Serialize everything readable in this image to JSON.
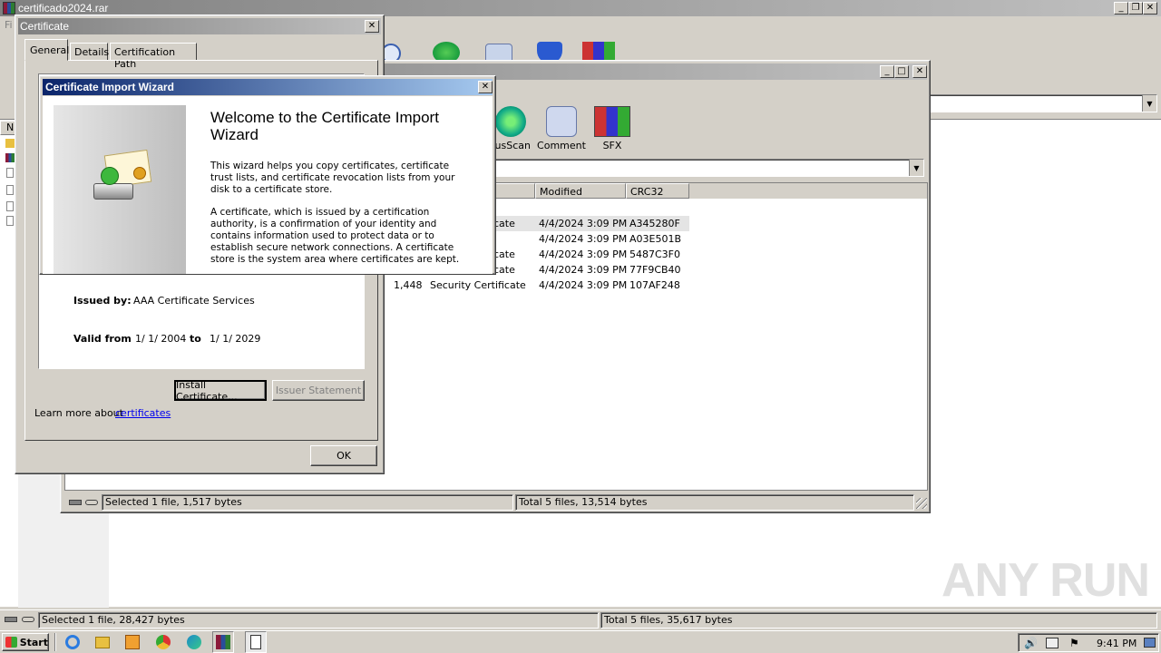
{
  "main_window": {
    "title": "certificado2024.rar",
    "menu_first": "Fi",
    "column_first": "N",
    "status_left": "Selected 1 file, 28,427 bytes",
    "status_right": "Total 5 files, 35,617 bytes"
  },
  "inner_window": {
    "toolbar": [
      {
        "label": "rusScan",
        "icon": "virusscan-icon"
      },
      {
        "label": "Comment",
        "icon": "comment-icon"
      },
      {
        "label": "SFX",
        "icon": "sfx-icon"
      }
    ],
    "columns": {
      "modified": "Modified",
      "crc": "CRC32"
    },
    "rows": [
      {
        "size": "",
        "type": "cate",
        "modified": "4/4/2024 3:09 PM",
        "crc": "A345280F"
      },
      {
        "size": "",
        "type": "",
        "modified": "4/4/2024 3:09 PM",
        "crc": "A03E501B"
      },
      {
        "size": "",
        "type": "cate",
        "modified": "4/4/2024 3:09 PM",
        "crc": "5487C3F0"
      },
      {
        "size": "",
        "type": "cate",
        "modified": "4/4/2024 3:09 PM",
        "crc": "77F9CB40"
      },
      {
        "size": "1,448",
        "type": "Security Certificate",
        "modified": "4/4/2024 3:09 PM",
        "crc": "107AF248"
      }
    ],
    "status_left": "Selected 1 file, 1,517 bytes",
    "status_right": "Total 5 files, 13,514 bytes"
  },
  "certificate_dialog": {
    "title": "Certificate",
    "tabs": [
      "General",
      "Details",
      "Certification Path"
    ],
    "issued_by_label": "Issued by:",
    "issued_by_value": "AAA Certificate Services",
    "valid_from_label": "Valid from",
    "valid_from_value": "1/ 1/ 2004",
    "to_label": "to",
    "valid_to_value": "1/ 1/ 2029",
    "install_button": "Install Certificate...",
    "issuer_button": "Issuer Statement",
    "learn_more_text": "Learn more about",
    "learn_more_link": "certificates",
    "ok_button": "OK"
  },
  "wizard": {
    "title": "Certificate Import Wizard",
    "heading": "Welcome to the Certificate Import Wizard",
    "para1": "This wizard helps you copy certificates, certificate trust lists, and certificate revocation lists from your disk to a certificate store.",
    "para2": "A certificate, which is issued by a certification authority, is a confirmation of your identity and contains information used to protect data or to establish secure network connections. A certificate store is the system area where certificates are kept."
  },
  "taskbar": {
    "start_label": "Start",
    "time": "9:41 PM"
  },
  "watermark": "ANY RUN",
  "colors": {
    "wizard_title_start": "#0a246a",
    "wizard_title_end": "#a6caf0",
    "link": "#0000ee",
    "face": "#d4d0c8"
  }
}
